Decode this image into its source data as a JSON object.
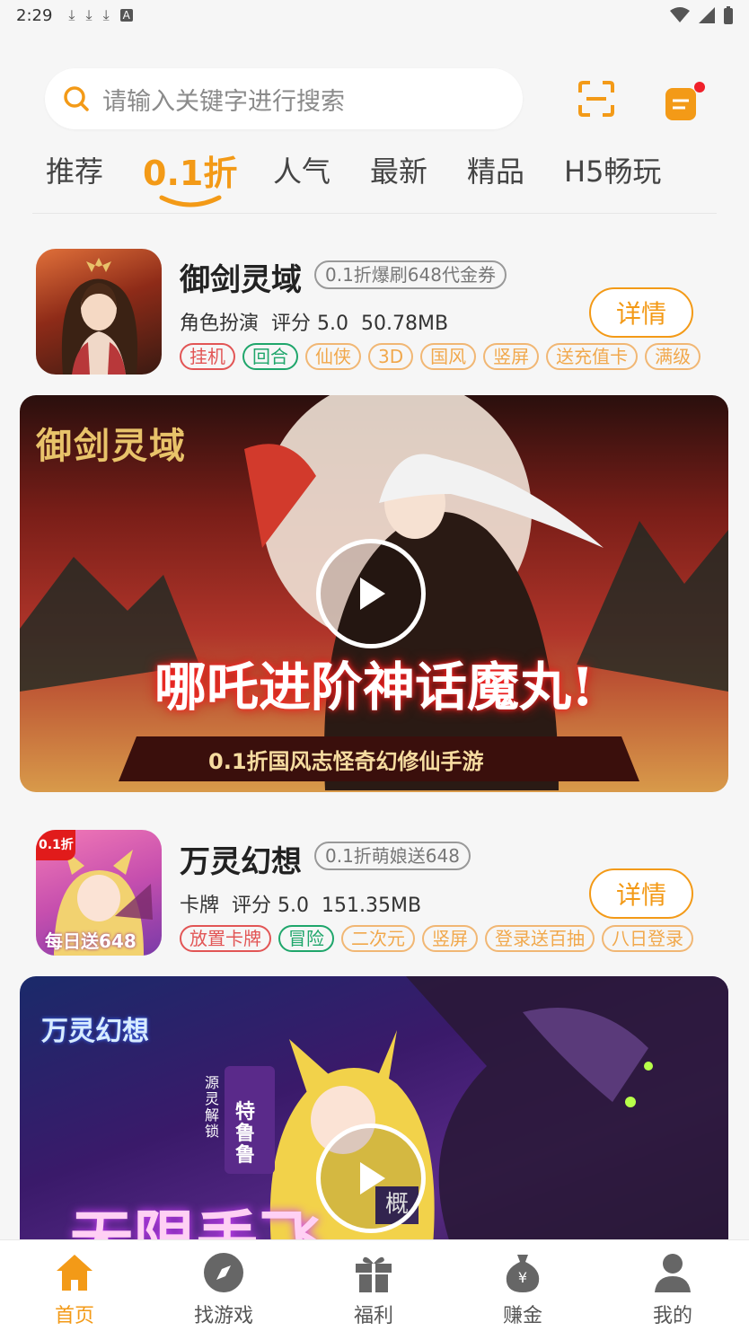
{
  "status_bar": {
    "time": "2:29"
  },
  "search": {
    "placeholder": "请输入关键字进行搜索"
  },
  "tabs": [
    {
      "label": "推荐"
    },
    {
      "label": "0.1折"
    },
    {
      "label": "人气"
    },
    {
      "label": "最新"
    },
    {
      "label": "精品"
    },
    {
      "label": "H5畅玩"
    }
  ],
  "games": [
    {
      "title": "御剑灵域",
      "promo": "0.1折爆刷648代金券",
      "category": "角色扮演",
      "rating": "评分 5.0",
      "size": "50.78MB",
      "detail_label": "详情",
      "tags": [
        "挂机",
        "回合",
        "仙侠",
        "3D",
        "国风",
        "竖屏",
        "送充值卡",
        "满级"
      ],
      "banner_logo": "御剑灵域",
      "banner_headline": "哪吒进阶神话魔丸!",
      "banner_subtitle": "0.1折国风志怪奇幻修仙手游"
    },
    {
      "title": "万灵幻想",
      "promo": "0.1折萌娘送648",
      "category": "卡牌",
      "rating": "评分 5.0",
      "size": "151.35MB",
      "detail_label": "详情",
      "tags": [
        "放置卡牌",
        "冒险",
        "二次元",
        "竖屏",
        "登录送百抽",
        "八日登录"
      ],
      "icon_badge": "0.1折",
      "icon_caption": "每日送648",
      "banner_logo": "万灵幻想",
      "banner_side_label": "源灵解锁",
      "banner_char_name": "特鲁鲁",
      "banner_headline": "无限丢飞",
      "banner_stamp": "概"
    }
  ],
  "bottom_nav": [
    {
      "label": "首页",
      "icon": "home-icon"
    },
    {
      "label": "找游戏",
      "icon": "compass-icon"
    },
    {
      "label": "福利",
      "icon": "gift-icon"
    },
    {
      "label": "赚金",
      "icon": "money-bag-icon"
    },
    {
      "label": "我的",
      "icon": "user-icon"
    }
  ],
  "colors": {
    "accent": "#f39a17",
    "tag_red": "#e25555",
    "tag_green": "#1fa66b",
    "tag_orange": "#f1a84c"
  }
}
